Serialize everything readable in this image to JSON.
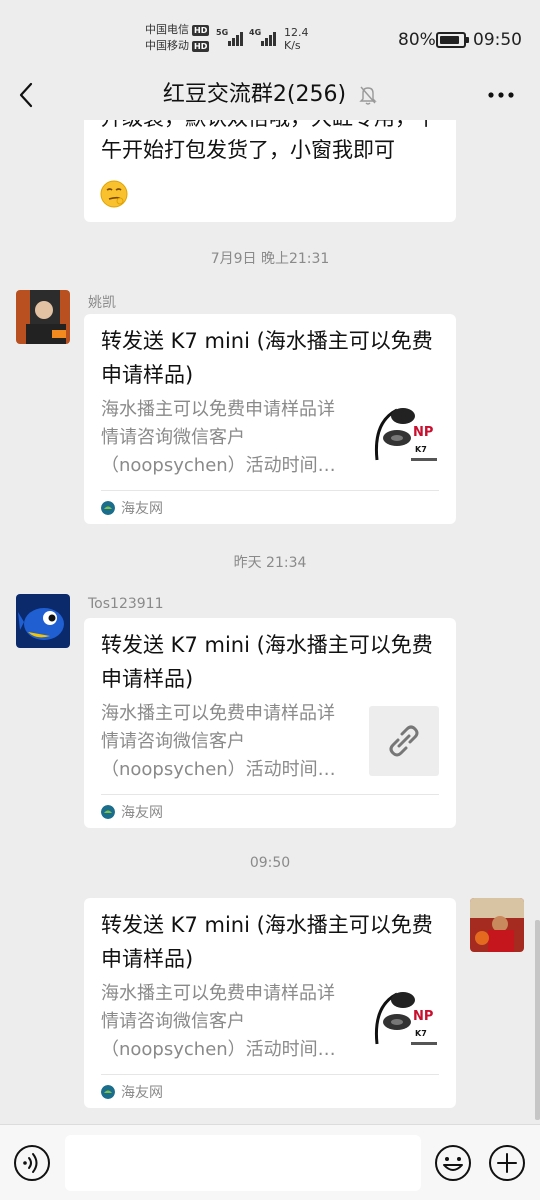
{
  "status_bar": {
    "carrier_1": "中国电信",
    "carrier_2": "中国移动",
    "hd": "HD",
    "network_1": "5G",
    "network_2": "4G",
    "speed_value": "12.4",
    "speed_unit": "K/s",
    "battery": "80%",
    "time": "09:50"
  },
  "header": {
    "title": "红豆交流群2(256)",
    "back_icon": "chevron-left-icon",
    "mute_icon": "bell-off-icon",
    "more_icon": "more-horizontal-icon"
  },
  "messages": {
    "partial": {
      "text": "升级装，默认双倍哦，大缸专用，下午开始打包发货了，小窗我即可",
      "emoji": "smirk-emoji"
    },
    "time_1": "7月9日 晚上21:31",
    "msg_1": {
      "sender": "姚凯",
      "title": "转发送 K7 mini (海水播主可以免费申请样品)",
      "desc": "海水播主可以免费申请样品详情请咨询微信客户（noopsychen）活动时间…",
      "source": "海友网"
    },
    "time_2": "昨天 21:34",
    "msg_2": {
      "sender": "Tos123911",
      "title": "转发送 K7 mini (海水播主可以免费申请样品)",
      "desc": "海水播主可以免费申请样品详情请咨询微信客户（noopsychen）活动时间…",
      "source": "海友网"
    },
    "time_3": "09:50",
    "msg_3": {
      "title": "转发送 K7 mini (海水播主可以免费申请样品)",
      "desc": "海水播主可以免费申请样品详情请咨询微信客户（noopsychen）活动时间…",
      "source": "海友网"
    }
  },
  "input_bar": {
    "placeholder": "",
    "voice_icon": "voice-icon",
    "emoji_icon": "emoji-icon",
    "plus_icon": "plus-icon"
  }
}
